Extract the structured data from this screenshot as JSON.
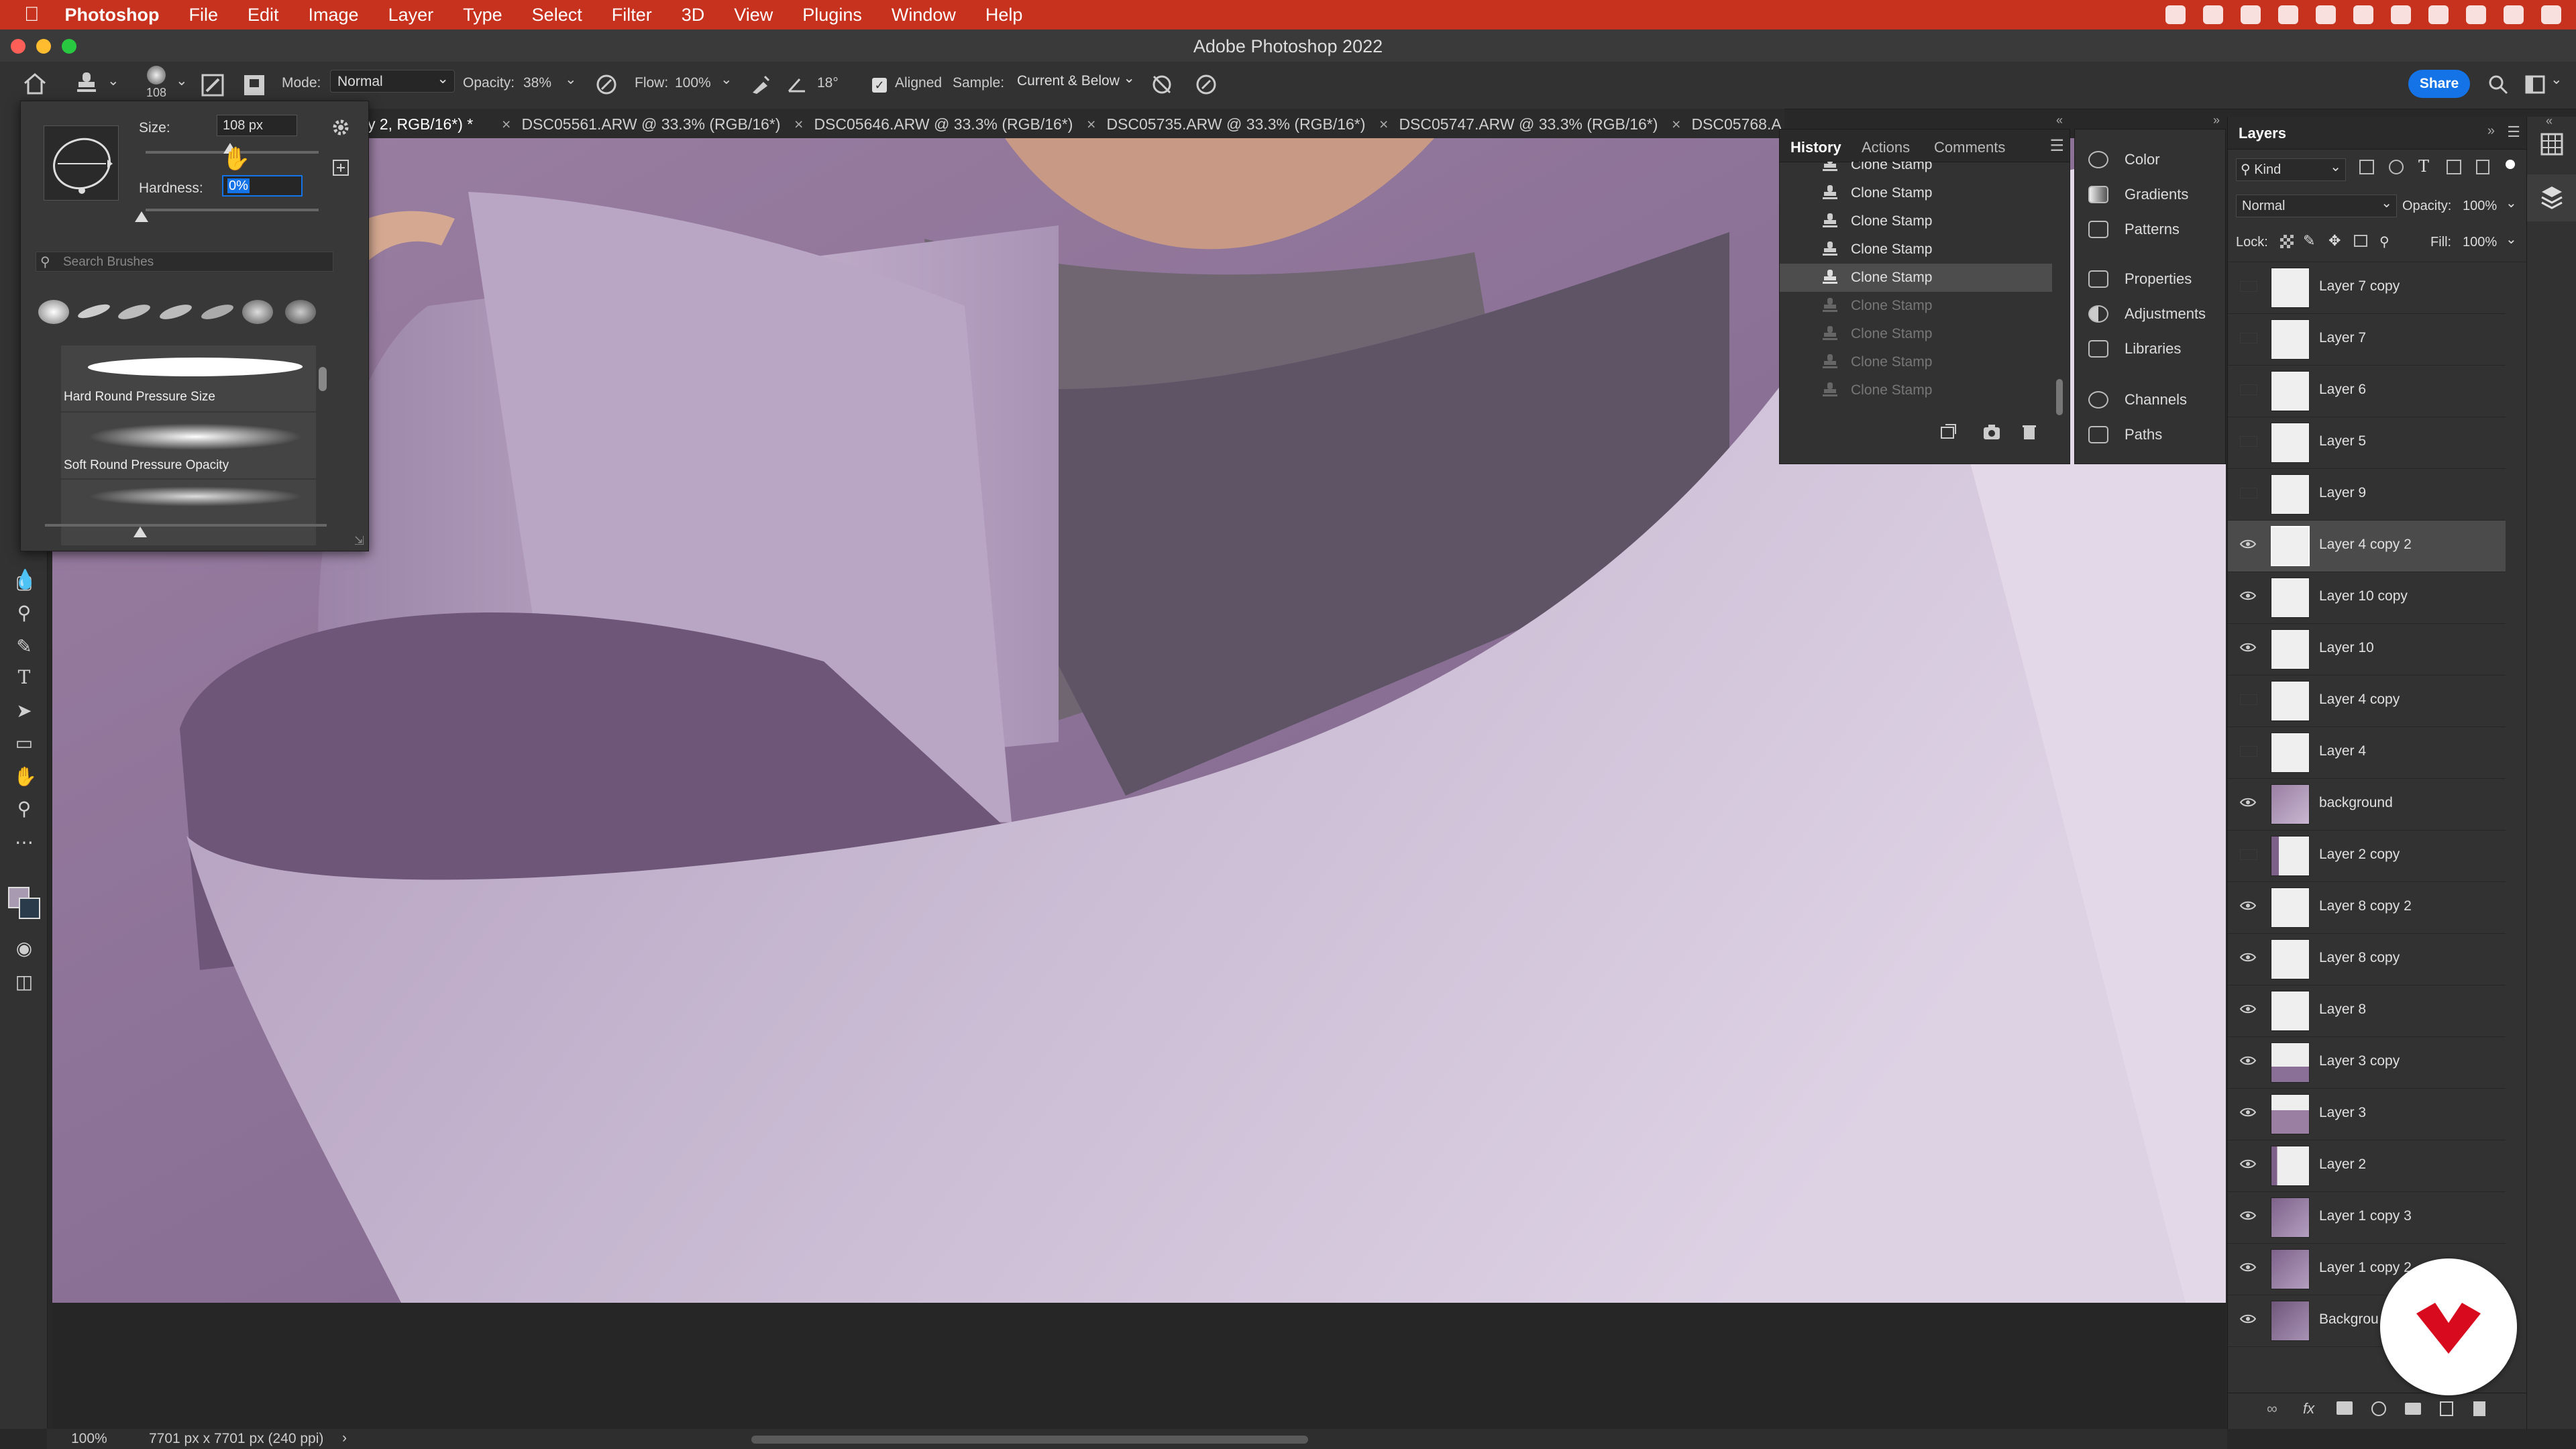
{
  "menubar": {
    "app_name": "Photoshop",
    "items": [
      "File",
      "Edit",
      "Image",
      "Layer",
      "Type",
      "Select",
      "Filter",
      "3D",
      "View",
      "Plugins",
      "Window",
      "Help"
    ]
  },
  "window": {
    "title": "Adobe Photoshop 2022"
  },
  "options_bar": {
    "brush_size_small": "108",
    "mode_label": "Mode:",
    "mode_value": "Normal",
    "opacity_label": "Opacity:",
    "opacity_value": "38%",
    "flow_label": "Flow:",
    "flow_value": "100%",
    "angle_value": "18°",
    "aligned_label": "Aligned",
    "sample_label": "Sample:",
    "sample_value": "Current & Below",
    "share_label": "Share"
  },
  "brush_popup": {
    "size_label": "Size:",
    "size_value": "108 px",
    "hardness_label": "Hardness:",
    "hardness_value": "0%",
    "search_placeholder": "Search Brushes",
    "presets": [
      {
        "name": "Hard Round Pressure Size"
      },
      {
        "name": "Soft Round Pressure Opacity"
      }
    ]
  },
  "doc_tabs": [
    {
      "label": "y 2, RGB/16*) *",
      "active": true
    },
    {
      "label": "DSC05561.ARW @ 33.3% (RGB/16*)"
    },
    {
      "label": "DSC05646.ARW @ 33.3% (RGB/16*)"
    },
    {
      "label": "DSC05735.ARW @ 33.3% (RGB/16*)"
    },
    {
      "label": "DSC05747.ARW @ 33.3% (RGB/16*)"
    },
    {
      "label": "DSC05768.A"
    }
  ],
  "history_panel": {
    "tabs": [
      "History",
      "Actions",
      "Comments"
    ],
    "items": [
      {
        "label": "Clone Stamp"
      },
      {
        "label": "Clone Stamp"
      },
      {
        "label": "Clone Stamp"
      },
      {
        "label": "Clone Stamp"
      },
      {
        "label": "Clone Stamp",
        "selected": true
      },
      {
        "label": "Clone Stamp",
        "dimmed": true
      },
      {
        "label": "Clone Stamp",
        "dimmed": true
      },
      {
        "label": "Clone Stamp",
        "dimmed": true
      },
      {
        "label": "Clone Stamp",
        "dimmed": true
      }
    ]
  },
  "collapsed_panels": {
    "group1": [
      "Color",
      "Gradients",
      "Patterns"
    ],
    "group2": [
      "Properties",
      "Adjustments",
      "Libraries"
    ],
    "group3": [
      "Channels",
      "Paths"
    ]
  },
  "layers_panel": {
    "title": "Layers",
    "filter_kind": "Kind",
    "blend_mode": "Normal",
    "opacity_label": "Opacity:",
    "opacity_value": "100%",
    "lock_label": "Lock:",
    "fill_label": "Fill:",
    "fill_value": "100%",
    "layers": [
      {
        "name": "Layer 7 copy",
        "visible": false
      },
      {
        "name": "Layer 7",
        "visible": false
      },
      {
        "name": "Layer 6",
        "visible": false
      },
      {
        "name": "Layer 5",
        "visible": false
      },
      {
        "name": "Layer 9",
        "visible": false
      },
      {
        "name": "Layer 4 copy 2",
        "visible": true,
        "selected": true
      },
      {
        "name": "Layer 10 copy",
        "visible": true
      },
      {
        "name": "Layer 10",
        "visible": true
      },
      {
        "name": "Layer 4 copy",
        "visible": false
      },
      {
        "name": "Layer 4",
        "visible": false
      },
      {
        "name": "background",
        "visible": true
      },
      {
        "name": "Layer 2 copy",
        "visible": false
      },
      {
        "name": "Layer 8 copy 2",
        "visible": true
      },
      {
        "name": "Layer 8 copy",
        "visible": true
      },
      {
        "name": "Layer 8",
        "visible": true
      },
      {
        "name": "Layer 3 copy",
        "visible": true
      },
      {
        "name": "Layer 3",
        "visible": true
      },
      {
        "name": "Layer 2",
        "visible": true
      },
      {
        "name": "Layer 1 copy 3",
        "visible": true
      },
      {
        "name": "Layer 1 copy 2",
        "visible": true
      },
      {
        "name": "Backgrou",
        "visible": true
      }
    ]
  },
  "status_bar": {
    "zoom": "100%",
    "doc_info": "7701 px x 7701 px (240 ppi)"
  },
  "colors": {
    "menubar": "#c7321e",
    "accent": "#1473e6",
    "canvas_purple": "#8c7196",
    "paper": "#cdbfd6",
    "logo_red": "#d80a1e"
  }
}
